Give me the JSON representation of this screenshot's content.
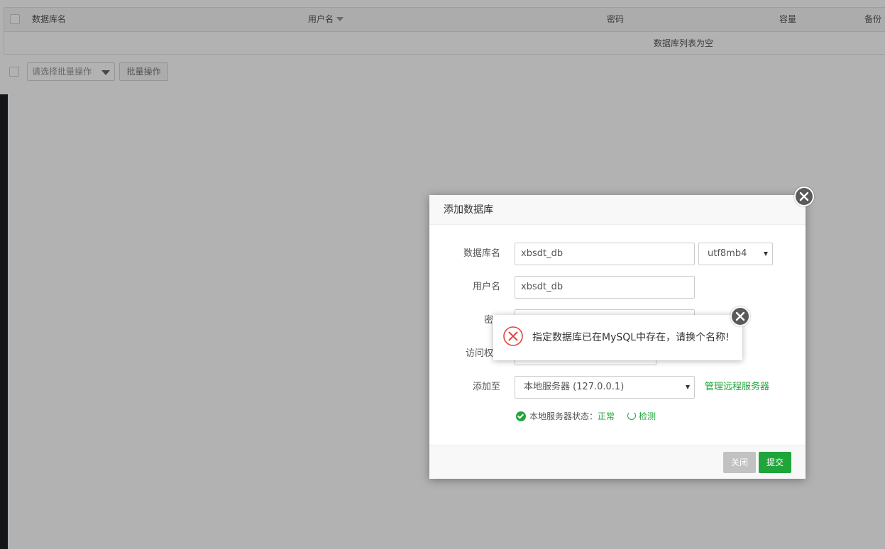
{
  "table": {
    "headers": [
      "数据库名",
      "用户名",
      "密码",
      "容量",
      "备份"
    ],
    "empty_text": "数据库列表为空"
  },
  "bulk": {
    "select_placeholder": "请选择批量操作",
    "button_label": "批量操作"
  },
  "modal": {
    "title": "添加数据库",
    "fields": {
      "db_name_label": "数据库名",
      "db_name_value": "xbsdt_db",
      "charset_value": "utf8mb4",
      "user_label": "用户名",
      "user_value": "xbsdt_db",
      "password_label_partial": "密",
      "access_label_partial": "访问权",
      "add_to_label": "添加至",
      "server_value": "本地服务器 (127.0.0.1)",
      "manage_remote_link": "管理远程服务器"
    },
    "status": {
      "label": "本地服务器状态：",
      "value": "正常",
      "detect_link": "检测"
    },
    "buttons": {
      "close": "关闭",
      "submit": "提交"
    }
  },
  "toast": {
    "message": "指定数据库已在MySQL中存在，请换个名称!"
  },
  "colors": {
    "accent_green": "#20a53a",
    "error_red": "#e0443f",
    "close_circle": "#5a5a5a"
  },
  "icons": [
    "checkbox",
    "sort-caret-icon",
    "close-icon",
    "error-x-icon",
    "check-circle-icon",
    "refresh-icon",
    "dropdown-arrow-icon"
  ]
}
